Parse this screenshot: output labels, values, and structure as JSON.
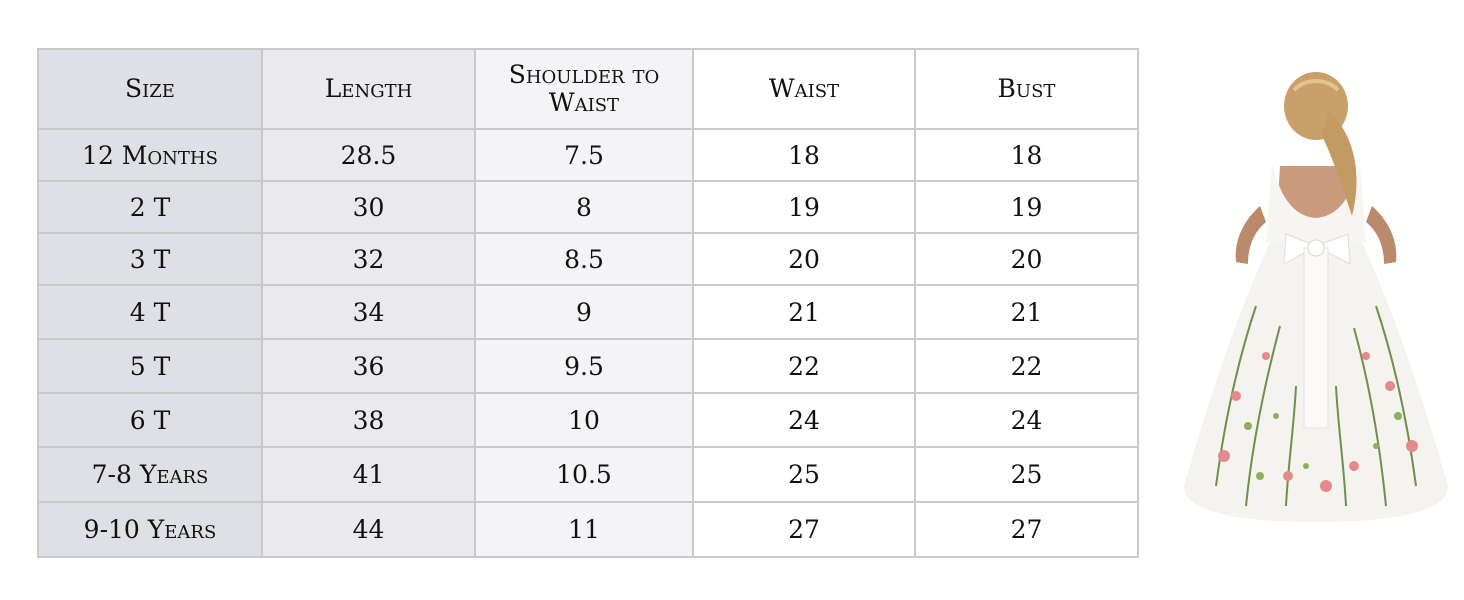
{
  "table": {
    "headers": [
      "Size",
      "Length",
      "Shoulder to Waist",
      "Waist",
      "Bust"
    ],
    "rows": [
      [
        "12 Months",
        "28.5",
        "7.5",
        "18",
        "18"
      ],
      [
        "2 T",
        "30",
        "8",
        "19",
        "19"
      ],
      [
        "3 T",
        "32",
        "8.5",
        "20",
        "20"
      ],
      [
        "4 T",
        "34",
        "9",
        "21",
        "21"
      ],
      [
        "5 T",
        "36",
        "9.5",
        "22",
        "22"
      ],
      [
        "6 T",
        "38",
        "10",
        "24",
        "24"
      ],
      [
        "7-8 Years",
        "41",
        "10.5",
        "25",
        "25"
      ],
      [
        "9-10 Years",
        "44",
        "11",
        "27",
        "27"
      ]
    ]
  },
  "photo": {
    "subject": "girl-in-floral-embroidered-white-ball-gown-back-view"
  }
}
